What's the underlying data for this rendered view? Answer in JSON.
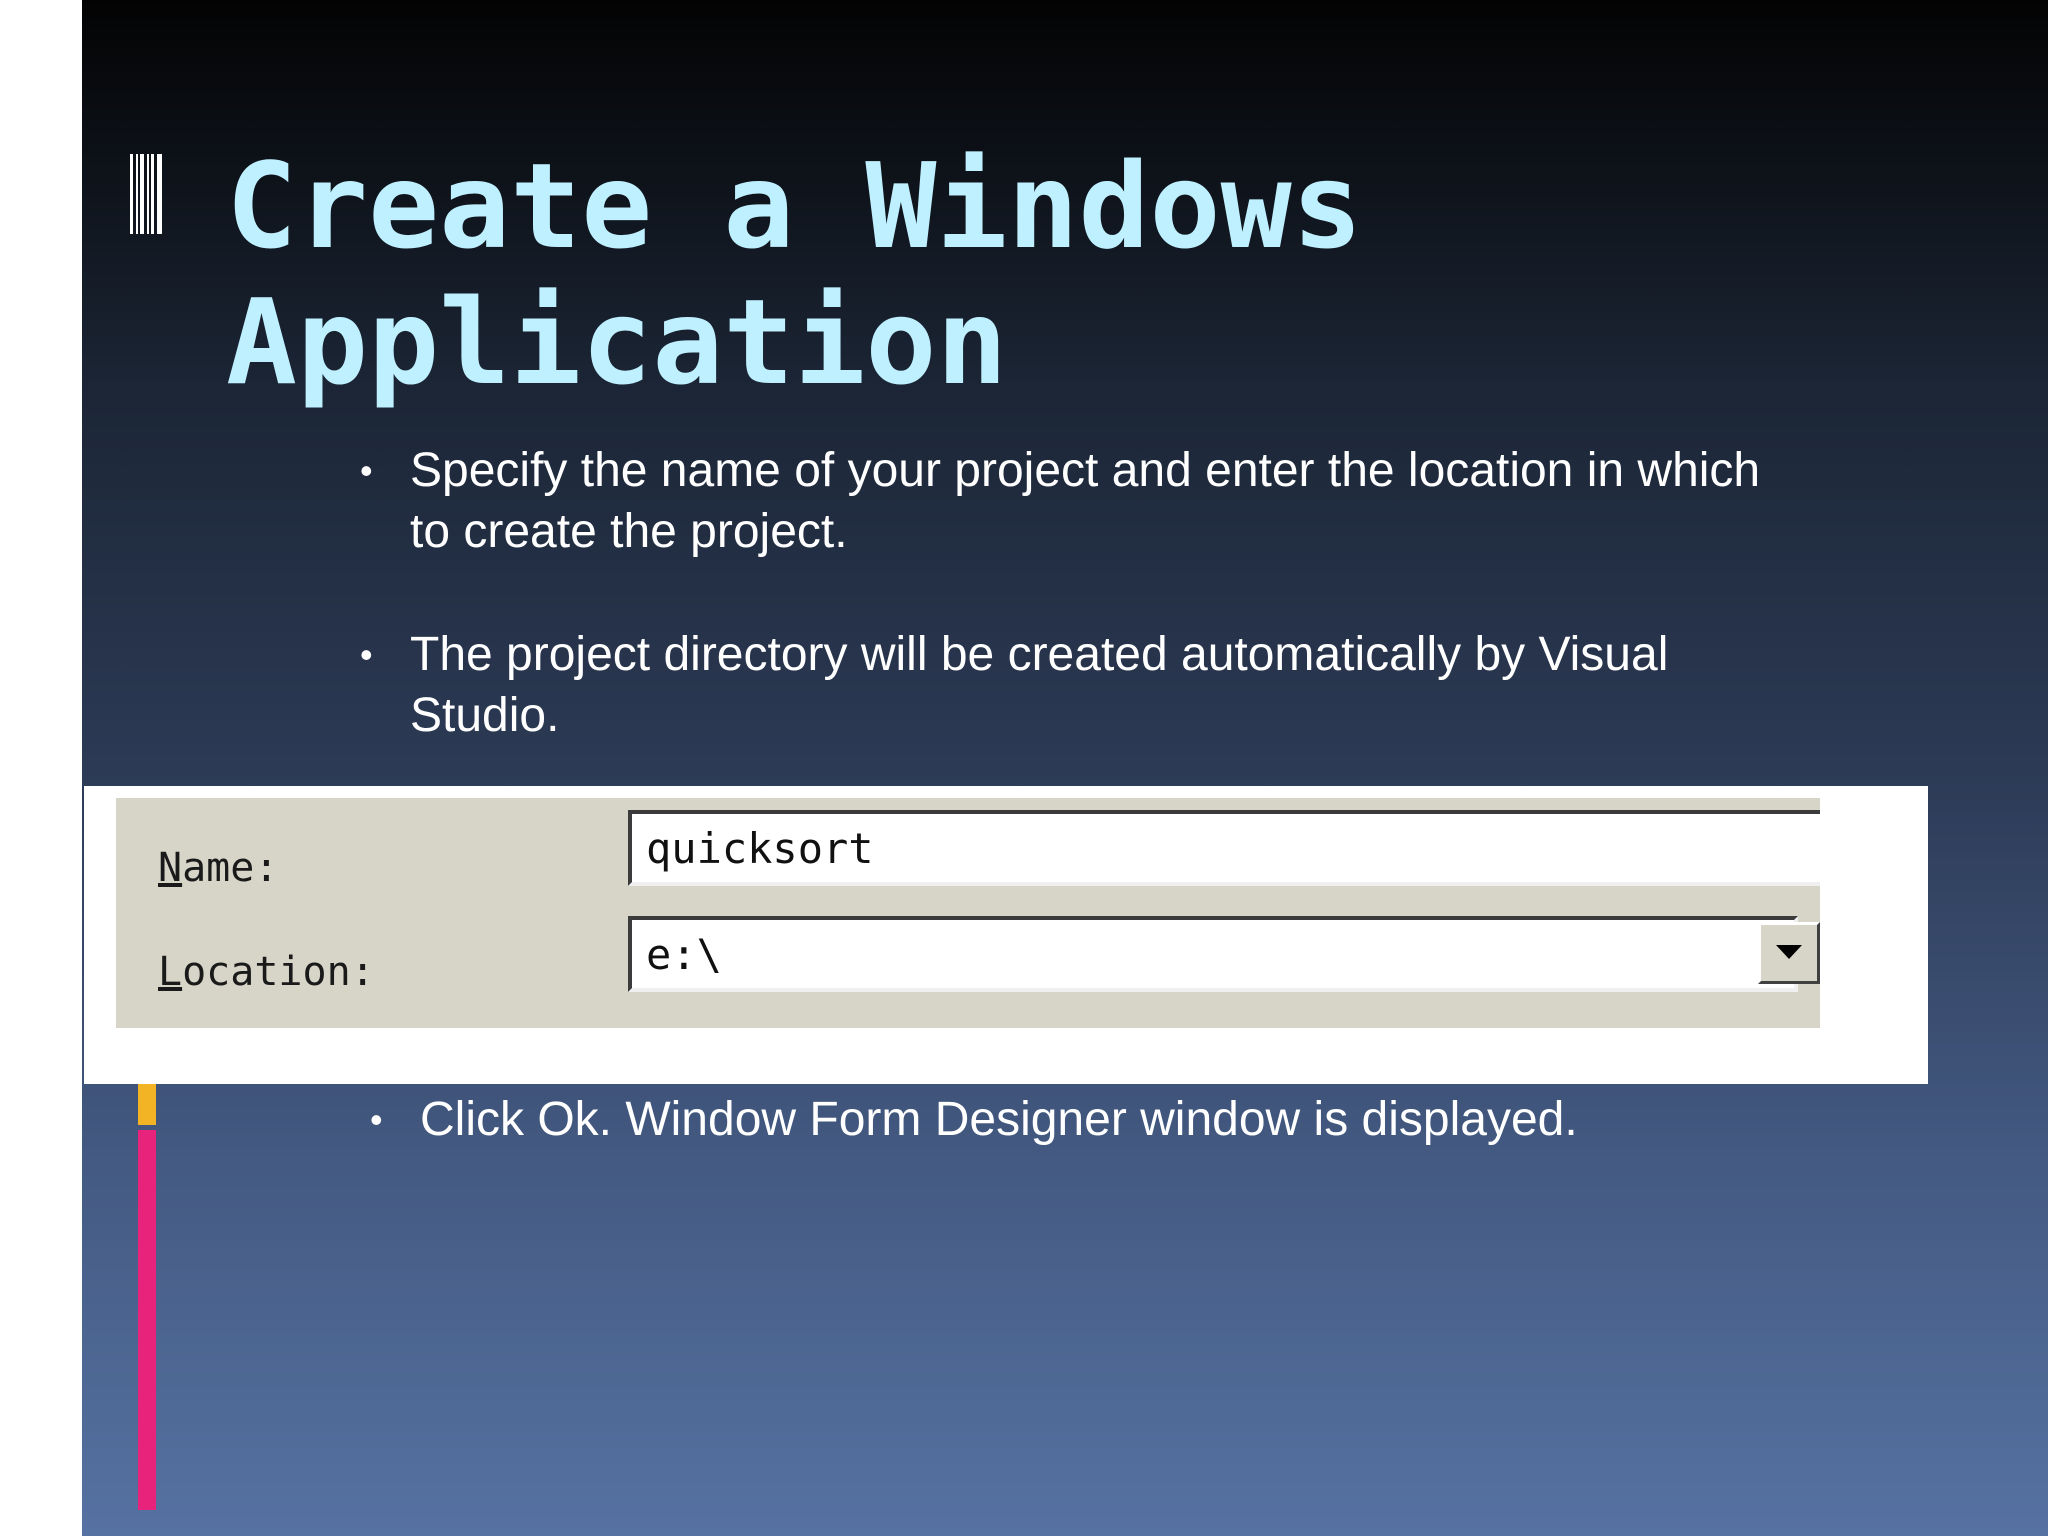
{
  "slide": {
    "title_line1": "Create a Windows",
    "title_line2": "Application",
    "bullets": [
      "Specify the name of your project and enter the location in which to create the project.",
      "The project directory will be created automatically by Visual Studio.",
      "Click Ok. Window Form Designer window is displayed."
    ],
    "bullet_glyph": "•"
  },
  "dialog": {
    "name_label_mnemonic": "N",
    "name_label_rest": "ame:",
    "name_value": "quicksort",
    "location_label_mnemonic": "L",
    "location_label_rest": "ocation:",
    "location_value": "e:\\",
    "dropdown_icon": "chevron-down-icon"
  },
  "colors": {
    "title": "#bff0ff",
    "accent_pink": "#e8237b",
    "accent_gold": "#f2b325"
  }
}
